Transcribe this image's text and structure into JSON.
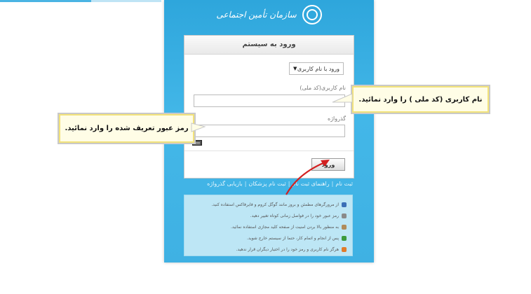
{
  "brand": {
    "name": "سازمان تأمین اجتماعی",
    "logo_icon": "tamin-logo-icon"
  },
  "login": {
    "title": "ورود به سیستم",
    "login_type_selected": "ورود با نام کاربری",
    "username_label": "نام کاربری(کد ملی)",
    "username_value": "",
    "password_label": "گذرواژه",
    "password_value": "",
    "keyboard_icon": "keyboard-icon",
    "submit_label": "ورود"
  },
  "links": [
    "ثبت نام",
    "راهنمای ثبت نام",
    "ثبت نام پزشکان",
    "بازیابی گذرواژه"
  ],
  "notes": [
    {
      "text": "از مرورگرهای مطمئن و بروز مانند گوگل کروم و فایرفاکس استفاده کنید.",
      "icon": "browser-icon",
      "color": "#3b6fb6"
    },
    {
      "text": "رمز عبور خود را در فواصل زمانی کوتاه تغییر دهید.",
      "icon": "key-icon",
      "color": "#8a8a8a"
    },
    {
      "text": "به منظور بالا بردن امنیت از صفحه کلید مجازی استفاده نمائید.",
      "icon": "keyboard-icon",
      "color": "#b08b5a"
    },
    {
      "text": "پس از انجام و اتمام کار، حتما از سیستم خارج شوید.",
      "icon": "exit-icon",
      "color": "#3c9a3c"
    },
    {
      "text": "هرگز نام کاربری و رمز خود را در اختیار دیگران قرار ندهید.",
      "icon": "warning-icon",
      "color": "#e07b2a"
    }
  ],
  "callouts": {
    "username_hint": "نام کاربری (کد ملی ) را وارد نمائید.",
    "password_hint": "رمز عبور تعریف شده را وارد نمائید."
  },
  "colors": {
    "panel": "#35abe0",
    "arrow": "#d32020",
    "callout_bg": "#fffde6"
  }
}
